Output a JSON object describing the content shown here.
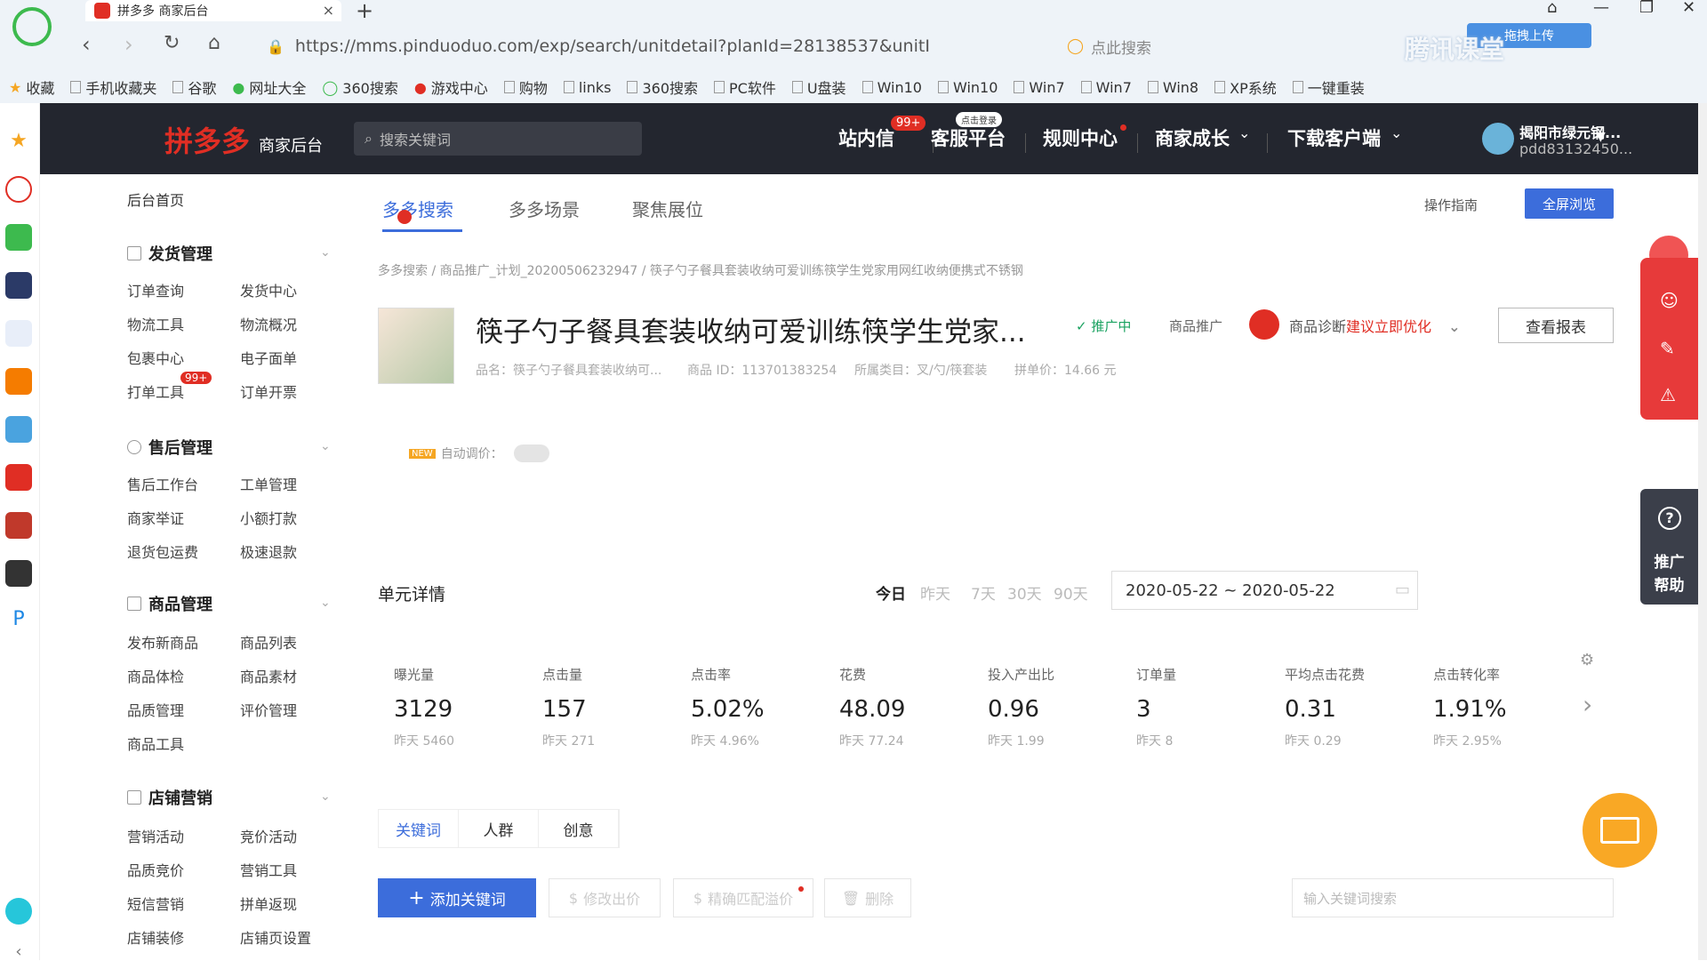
{
  "browser": {
    "tab_title": "拼多多 商家后台",
    "url": "https://mms.pinduoduo.com/exp/search/unitdetail?planId=28138537&unitI",
    "search_placeholder": "点此搜索",
    "upload_label": "拖拽上传",
    "watermark": "腾讯课堂",
    "bookmarks": [
      "收藏",
      "手机收藏夹",
      "谷歌",
      "网址大全",
      "360搜索",
      "游戏中心",
      "购物",
      "links",
      "360搜索",
      "PC软件",
      "U盘装",
      "Win10",
      "Win10",
      "Win7",
      "Win7",
      "Win8",
      "XP系统",
      "一键重装"
    ]
  },
  "header": {
    "logo": "拼多多",
    "logo_sub": "商家后台",
    "search_placeholder": "搜索关键词",
    "nav": [
      "站内信",
      "客服平台",
      "规则中心",
      "商家成长",
      "下载客户端"
    ],
    "badge_inbox": "99+",
    "badge_service": "点击登录",
    "shop_name": "揭阳市绿元钢...",
    "shop_id": "pdd83132450..."
  },
  "sidebar": {
    "home": "后台首页",
    "groups": [
      {
        "title": "发货管理",
        "items": [
          "订单查询",
          "发货中心",
          "物流工具",
          "物流概况",
          "包裹中心",
          "电子面单",
          "打单工具",
          "订单开票"
        ]
      },
      {
        "title": "售后管理",
        "items": [
          "售后工作台",
          "工单管理",
          "商家举证",
          "小额打款",
          "退货包运费",
          "极速退款"
        ]
      },
      {
        "title": "商品管理",
        "items": [
          "发布新商品",
          "商品列表",
          "商品体检",
          "商品素材",
          "品质管理",
          "评价管理",
          "商品工具"
        ]
      },
      {
        "title": "店铺营销",
        "items": [
          "营销活动",
          "竞价活动",
          "品质竞价",
          "营销工具",
          "短信营销",
          "拼单返现",
          "店铺装修",
          "店铺页设置"
        ]
      }
    ],
    "badge": "99+"
  },
  "main": {
    "tabs": [
      "多多搜索",
      "多多场景",
      "聚焦展位"
    ],
    "guide": "操作指南",
    "fullscreen": "全屏浏览",
    "breadcrumb": "多多搜索 / 商品推广_计划_20200506232947 / 筷子勺子餐具套装收纳可爱训练筷学生党家用网红收纳便携式不锈钢",
    "product_title": "筷子勺子餐具套装收纳可爱训练筷学生党家...",
    "promo_status": "推广中",
    "promo_type": "商品推广",
    "diag_label": "商品诊断",
    "diag_link": "建议立即优化",
    "report_button": "查看报表",
    "meta_name": "品名：筷子勺子餐具套装收纳可...",
    "meta_id": "商品 ID：113701383254",
    "meta_category": "所属类目：叉/勺/筷套装",
    "meta_price": "拼单价：14.66 元",
    "autobid_new": "NEW",
    "autobid_label": "自动调价：",
    "unit_title": "单元详情",
    "ranges": [
      "今日",
      "昨天",
      "7天",
      "30天",
      "90天"
    ],
    "date_range": "2020-05-22 ~ 2020-05-22",
    "metrics": [
      {
        "label": "曝光量",
        "value": "3129",
        "prev": "昨天 5460"
      },
      {
        "label": "点击量",
        "value": "157",
        "prev": "昨天 271"
      },
      {
        "label": "点击率",
        "value": "5.02%",
        "prev": "昨天 4.96%"
      },
      {
        "label": "花费",
        "value": "48.09",
        "prev": "昨天 77.24"
      },
      {
        "label": "投入产出比",
        "value": "0.96",
        "prev": "昨天 1.99"
      },
      {
        "label": "订单量",
        "value": "3",
        "prev": "昨天 8"
      },
      {
        "label": "平均点击花费",
        "value": "0.31",
        "prev": "昨天 0.29"
      },
      {
        "label": "点击转化率",
        "value": "1.91%",
        "prev": "昨天 2.95%"
      }
    ],
    "subtabs": [
      "关键词",
      "人群",
      "创意"
    ],
    "add_keyword": "添加关键词",
    "modify_bid": "修改出价",
    "precise_match": "精确匹配溢价",
    "delete": "删除",
    "kw_search_placeholder": "输入关键词搜索"
  },
  "right_tools": {
    "help": "推广帮助"
  },
  "colors": {
    "brand": "#e02e24",
    "accent": "#3c6ddb",
    "header_bg": "#23262f"
  }
}
